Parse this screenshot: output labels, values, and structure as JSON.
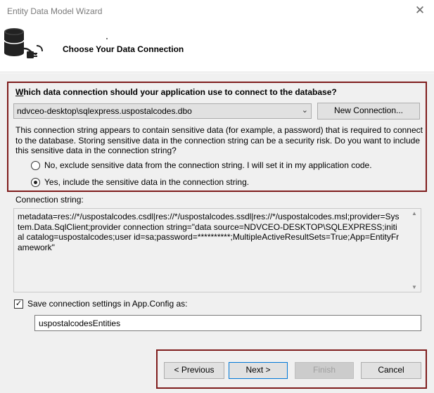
{
  "window": {
    "title": "Entity Data Model Wizard",
    "close_glyph": "✕"
  },
  "header": {
    "page_title": "Choose Your Data Connection",
    "icon": "database-plug-icon"
  },
  "connection": {
    "question": "Which data connection should your application use to connect to the database?",
    "question_accel": "W",
    "question_rest": "hich data connection should your application use to connect to the database?",
    "selected": "ndvceo-desktop\\sqlexpress.uspostalcodes.dbo",
    "new_connection_label": "New Connection...",
    "warning": "This connection string appears to contain sensitive data (for example, a password) that is required to connect to the database. Storing sensitive data in the connection string can be a security risk. Do you want to include this sensitive data in the connection string?",
    "option_exclude": "No, exclude sensitive data from the connection string. I will set it in my application code.",
    "option_include": "Yes, include the sensitive data in the connection string.",
    "selected_option": "include"
  },
  "connection_string": {
    "label": "Connection string:",
    "value": "metadata=res://*/uspostalcodes.csdl|res://*/uspostalcodes.ssdl|res://*/uspostalcodes.msl;provider=System.Data.SqlClient;provider connection string=\"data source=NDVCEO-DESKTOP\\SQLEXPRESS;initial catalog=uspostalcodes;user id=sa;password=**********;MultipleActiveResultSets=True;App=EntityFramework\""
  },
  "save_settings": {
    "label": "Save connection settings in App.Config as:",
    "checked": true,
    "name": "uspostalcodesEntities"
  },
  "footer": {
    "previous": "< Previous",
    "next": "Next >",
    "finish": "Finish",
    "cancel": "Cancel"
  },
  "colors": {
    "highlight_border": "#7f1d1d",
    "dialog_bg": "#f0f0f0",
    "default_button_border": "#0078d7"
  }
}
